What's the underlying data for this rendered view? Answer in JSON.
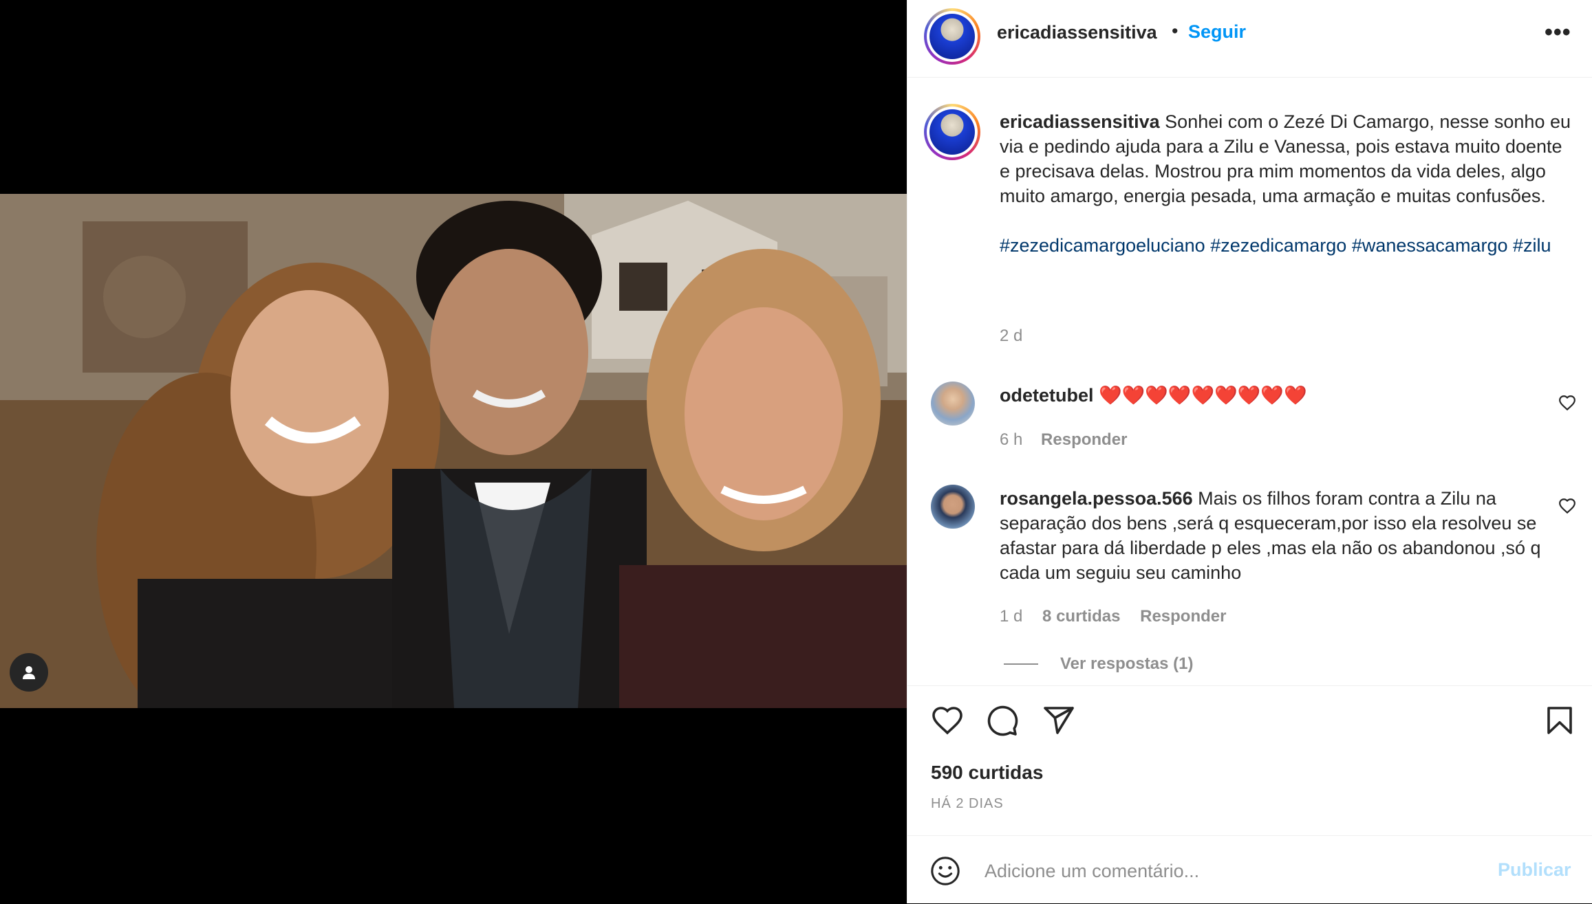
{
  "post": {
    "username": "ericadiassensitiva",
    "separator": "•",
    "follow_label": "Seguir",
    "more_label": "•••"
  },
  "caption": {
    "username": "ericadiassensitiva",
    "text": "Sonhei com o Zezé Di Camargo, nesse sonho eu via e pedindo ajuda para a Zilu e Vanessa, pois estava muito doente e precisava delas. Mostrou pra mim momentos da vida deles, algo muito amargo, energia pesada, uma armação e muitas confusões.",
    "hashtags": [
      "#zezedicamargoeluciano",
      "#zezedicamargo",
      "#wanessacamargo",
      "#zilu"
    ],
    "time": "2 d"
  },
  "comments": [
    {
      "username": "odetetubel",
      "text": "❤️❤️❤️❤️❤️❤️❤️❤️❤️",
      "time": "6 h",
      "reply_label": "Responder"
    },
    {
      "username": "rosangela.pessoa.566",
      "text": "Mais os filhos foram contra a Zilu na separação dos bens ,será q esqueceram,por isso ela resolveu se afastar para dá liberdade p eles ,mas ela não os abandonou ,só q cada um seguiu seu caminho",
      "time": "1 d",
      "likes": "8 curtidas",
      "reply_label": "Responder",
      "view_replies": "Ver respostas (1)"
    }
  ],
  "actions": {
    "likes": "590 curtidas",
    "age": "HÁ 2 DIAS"
  },
  "composer": {
    "placeholder": "Adicione um comentário...",
    "publish_label": "Publicar"
  },
  "colors": {
    "link": "#0095f6",
    "hashtag": "#00376b",
    "muted": "#8e8e8e",
    "text": "#262626"
  }
}
